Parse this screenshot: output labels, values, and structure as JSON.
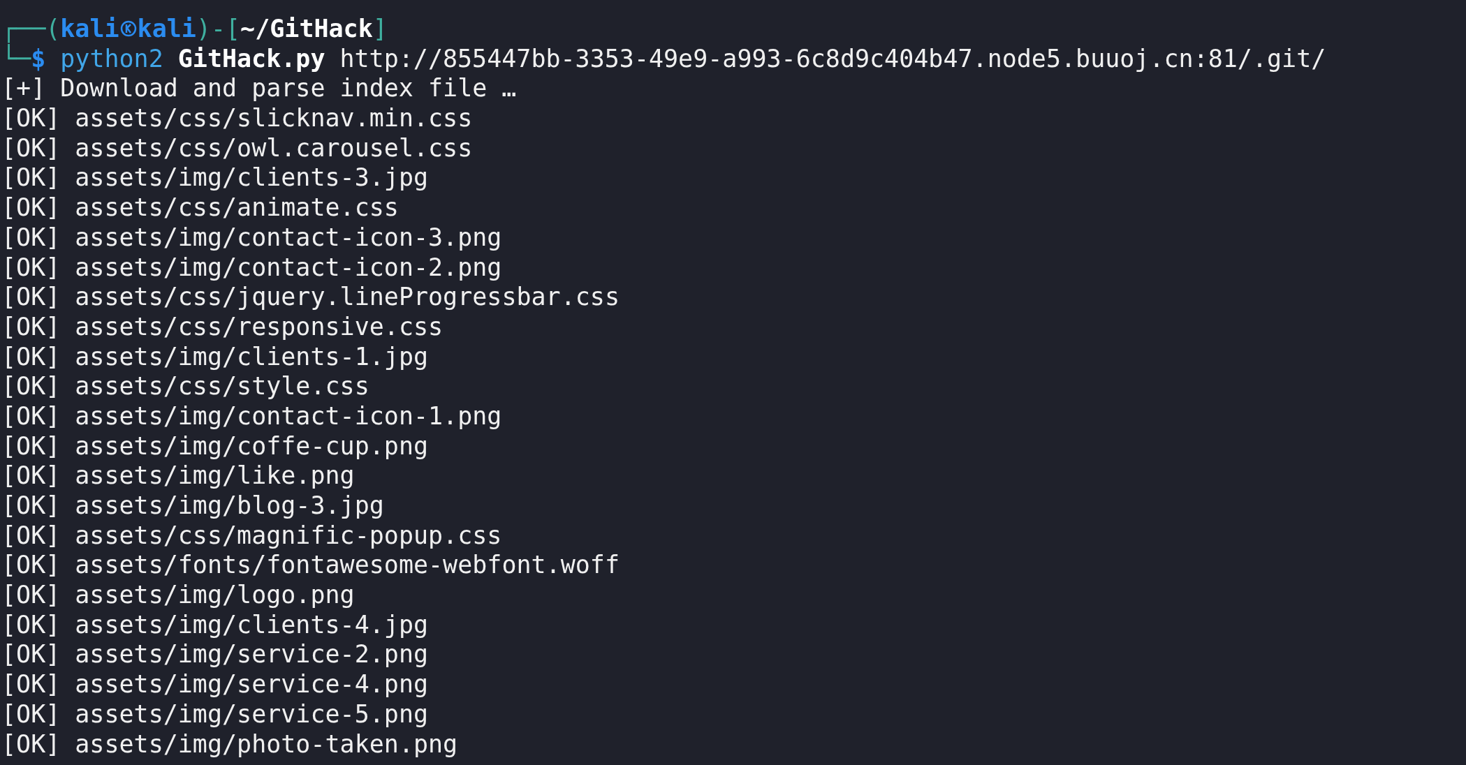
{
  "prompt": {
    "corner_top": "┌──(",
    "user": "kali",
    "host": "kali",
    "bracket_mid": ")-[",
    "directory": "~/GitHack",
    "bracket_end": "]",
    "corner_bottom": "└─",
    "symbol": "$"
  },
  "command": {
    "program": "python2",
    "script": "GitHack.py",
    "argument": "http://855447bb-3353-49e9-a993-6c8d9c404b47.node5.buuoj.cn:81/.git/"
  },
  "output": [
    {
      "tag": "[+]",
      "text": "Download and parse index file …"
    },
    {
      "tag": "[OK]",
      "text": "assets/css/slicknav.min.css"
    },
    {
      "tag": "[OK]",
      "text": "assets/css/owl.carousel.css"
    },
    {
      "tag": "[OK]",
      "text": "assets/img/clients-3.jpg"
    },
    {
      "tag": "[OK]",
      "text": "assets/css/animate.css"
    },
    {
      "tag": "[OK]",
      "text": "assets/img/contact-icon-3.png"
    },
    {
      "tag": "[OK]",
      "text": "assets/img/contact-icon-2.png"
    },
    {
      "tag": "[OK]",
      "text": "assets/css/jquery.lineProgressbar.css"
    },
    {
      "tag": "[OK]",
      "text": "assets/css/responsive.css"
    },
    {
      "tag": "[OK]",
      "text": "assets/img/clients-1.jpg"
    },
    {
      "tag": "[OK]",
      "text": "assets/css/style.css"
    },
    {
      "tag": "[OK]",
      "text": "assets/img/contact-icon-1.png"
    },
    {
      "tag": "[OK]",
      "text": "assets/img/coffe-cup.png"
    },
    {
      "tag": "[OK]",
      "text": "assets/img/like.png"
    },
    {
      "tag": "[OK]",
      "text": "assets/img/blog-3.jpg"
    },
    {
      "tag": "[OK]",
      "text": "assets/css/magnific-popup.css"
    },
    {
      "tag": "[OK]",
      "text": "assets/fonts/fontawesome-webfont.woff"
    },
    {
      "tag": "[OK]",
      "text": "assets/img/logo.png"
    },
    {
      "tag": "[OK]",
      "text": "assets/img/clients-4.jpg"
    },
    {
      "tag": "[OK]",
      "text": "assets/img/service-2.png"
    },
    {
      "tag": "[OK]",
      "text": "assets/img/service-4.png"
    },
    {
      "tag": "[OK]",
      "text": "assets/img/service-5.png"
    },
    {
      "tag": "[OK]",
      "text": "assets/img/photo-taken.png"
    }
  ]
}
